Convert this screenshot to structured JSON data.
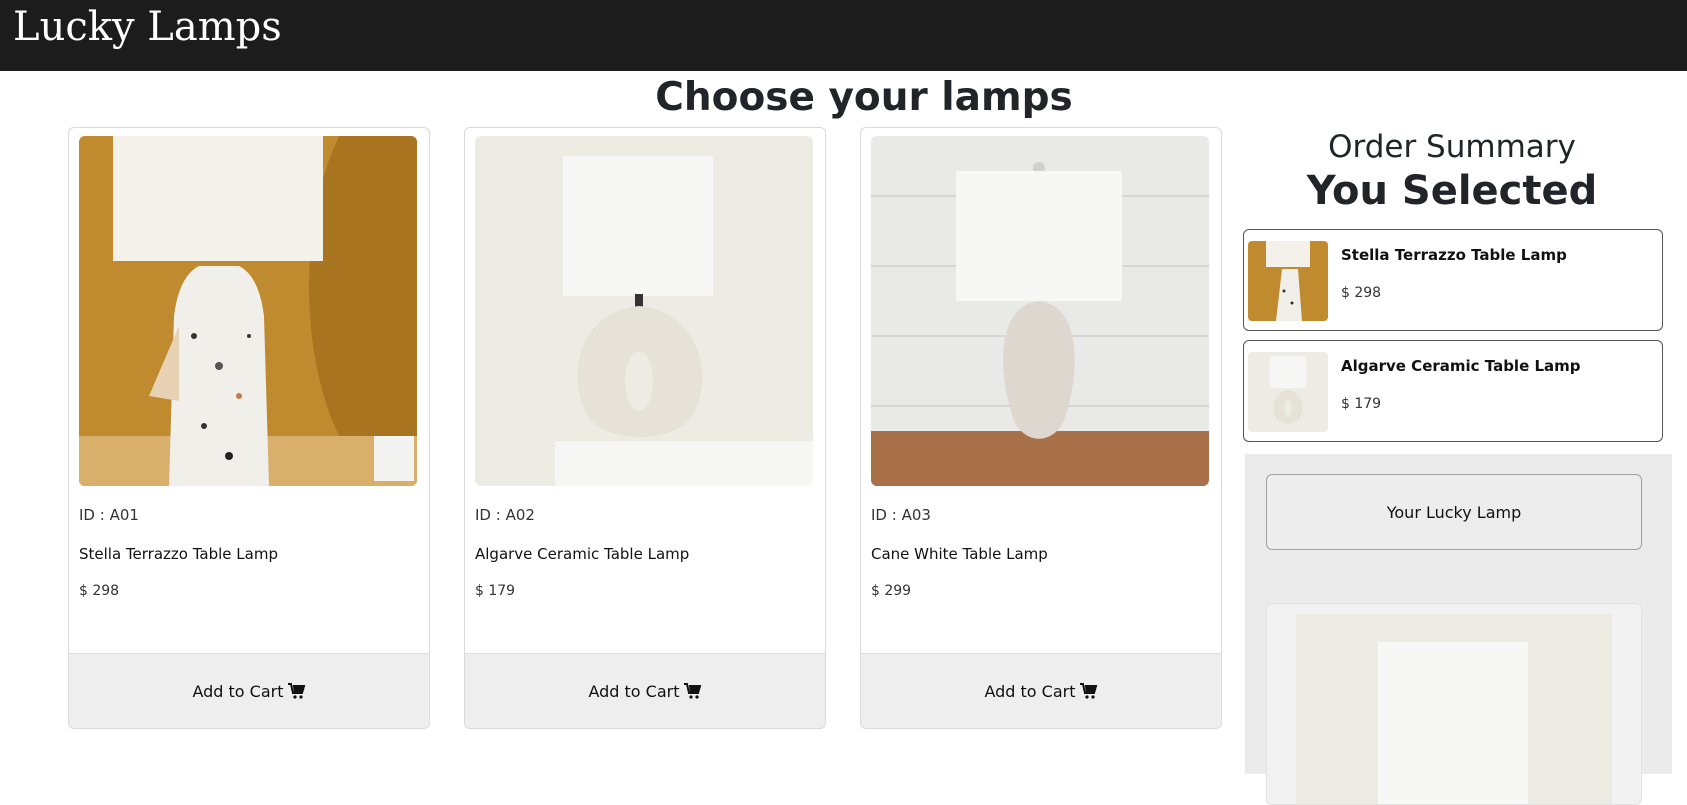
{
  "brand": "Lucky Lamps",
  "page_title": "Choose your lamps",
  "products": [
    {
      "id": "ID : A01",
      "name": "Stella Terrazzo Table Lamp",
      "price": "$ 298",
      "button": "Add to Cart"
    },
    {
      "id": "ID : A02",
      "name": "Algarve Ceramic Table Lamp",
      "price": "$ 179",
      "button": "Add to Cart"
    },
    {
      "id": "ID : A03",
      "name": "Cane White Table Lamp",
      "price": "$ 299",
      "button": "Add to Cart"
    }
  ],
  "summary": {
    "title": "Order Summary",
    "subtitle": "You Selected",
    "items": [
      {
        "name": "Stella Terrazzo Table Lamp",
        "price": "$ 298"
      },
      {
        "name": "Algarve Ceramic Table Lamp",
        "price": "$ 179"
      }
    ],
    "lucky_button": "Your Lucky Lamp"
  },
  "icons": {
    "cart": "shopping-cart-icon"
  },
  "colors": {
    "header_bg": "#1c1c1c",
    "card_footer": "#eeeeee",
    "panel_bg": "#ebebeb"
  }
}
